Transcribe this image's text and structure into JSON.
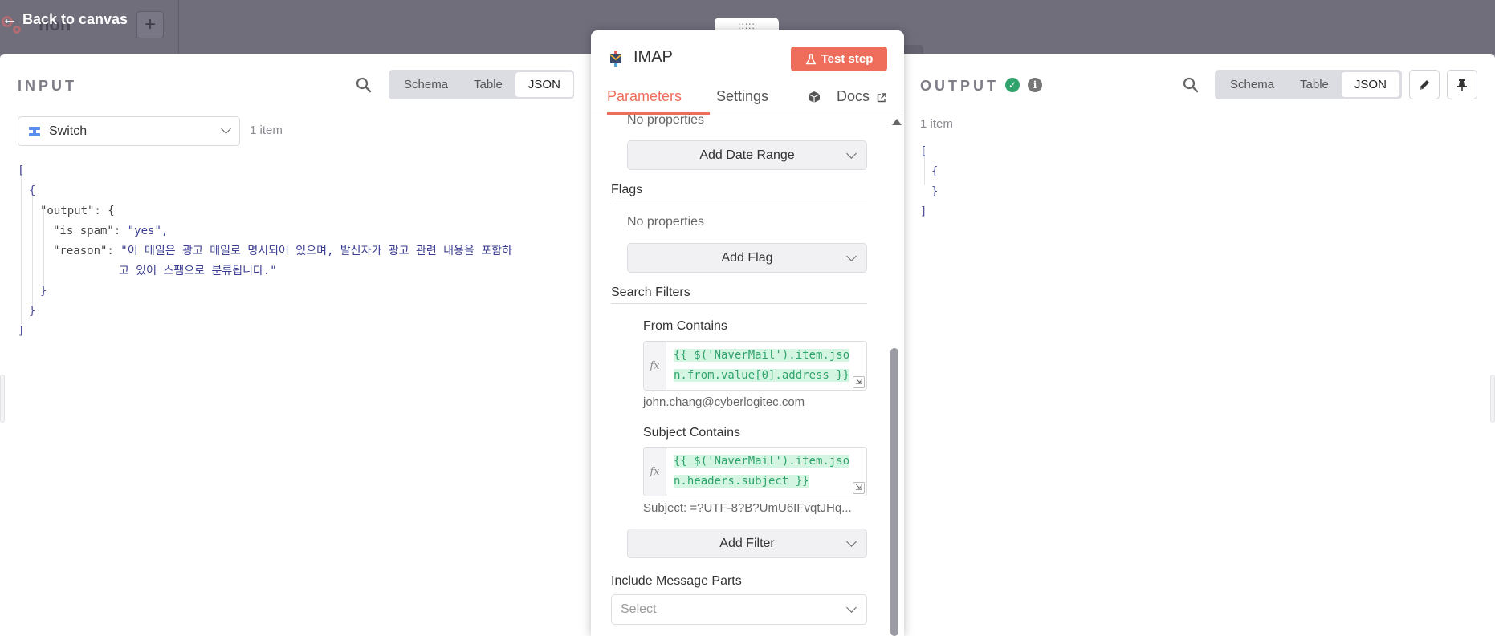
{
  "topbar": {
    "back_label": "Back to canvas",
    "ghost_text": "non",
    "plus_label": "+"
  },
  "center": {
    "drag_handle": ":::::",
    "node_title": "IMAP",
    "test_step_label": "Test step",
    "tabs": {
      "parameters": "Parameters",
      "settings": "Settings",
      "docs": "Docs"
    },
    "date_range": {
      "empty_label": "No properties",
      "add_label": "Add Date Range"
    },
    "flags": {
      "title": "Flags",
      "empty_label": "No properties",
      "add_label": "Add Flag"
    },
    "search_filters": {
      "title": "Search Filters",
      "from": {
        "label": "From Contains",
        "fx": "fx",
        "code_line1": "{{ $('NaverMail').item.jso",
        "code_line2": "n.from.value[0].address }}",
        "hint": "john.chang@cyberlogitec.com"
      },
      "subject": {
        "label": "Subject Contains",
        "fx": "fx",
        "code_line1": "{{ $('NaverMail').item.jso",
        "code_line2": "n.headers.subject }}",
        "hint": "Subject: =?UTF-8?B?UmU6IFvqtJHq..."
      },
      "add_label": "Add Filter"
    },
    "include_parts": {
      "label": "Include Message Parts",
      "placeholder": "Select"
    }
  },
  "input": {
    "title": "INPUT",
    "views": [
      "Schema",
      "Table",
      "JSON"
    ],
    "active_view": "JSON",
    "node_select": "Switch",
    "items_count": "1 item",
    "json": {
      "open_bracket": "[",
      "open_brace": "{",
      "output_key": "\"output\": {",
      "is_spam_key": "\"is_spam\":",
      "is_spam_value": "\"yes\",",
      "reason_key": "\"reason\":",
      "reason_line1": "\"이 메일은 광고 메일로 명시되어 있으며, 발신자가 광고 관련 내용을 포함하",
      "reason_line2": "고 있어 스팸으로 분류됩니다.\"",
      "close_inner": "}",
      "close_brace": "}",
      "close_bracket": "]"
    }
  },
  "output": {
    "title": "OUTPUT",
    "views": [
      "Schema",
      "Table",
      "JSON"
    ],
    "active_view": "JSON",
    "items_count": "1 item",
    "json": {
      "open_bracket": "[",
      "open_brace": "{",
      "close_brace": "}",
      "close_bracket": "]"
    }
  },
  "colors": {
    "accent": "#ee6e5b",
    "success": "#30a46c",
    "json_text": "#3a3c91"
  }
}
